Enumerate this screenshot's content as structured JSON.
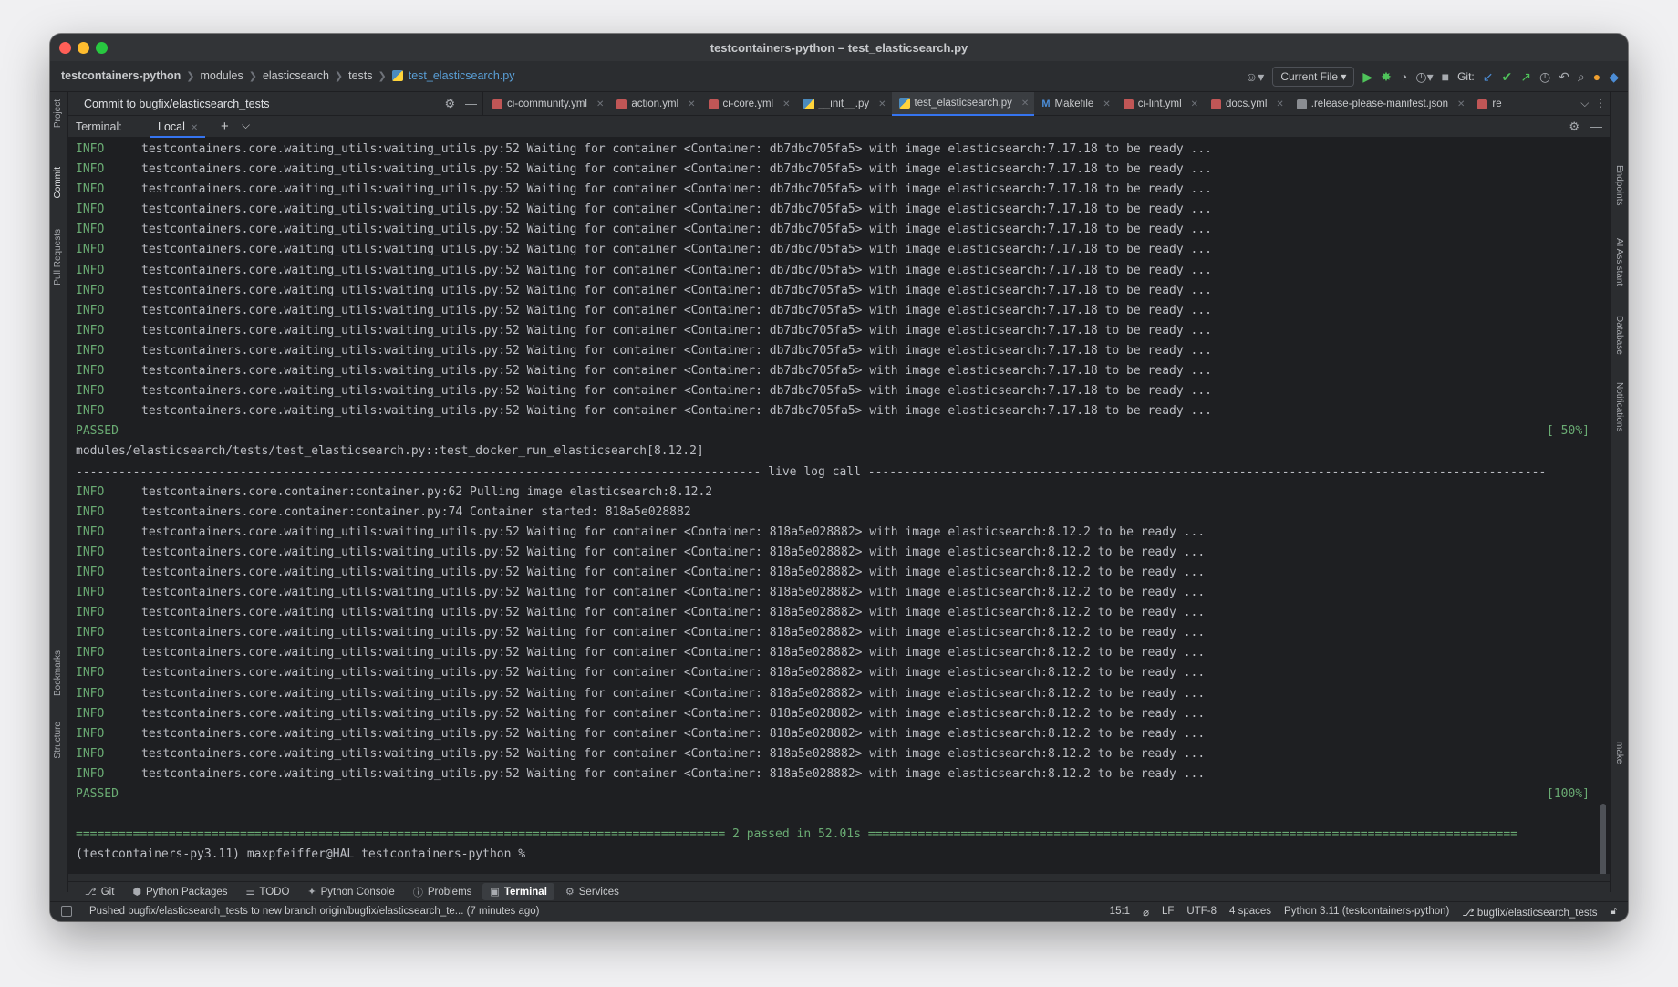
{
  "window": {
    "title": "testcontainers-python – test_elasticsearch.py"
  },
  "breadcrumb": {
    "items": [
      "testcontainers-python",
      "modules",
      "elasticsearch",
      "tests",
      "test_elasticsearch.py"
    ]
  },
  "toolbar": {
    "run_config": "Current File",
    "git_label": "Git:"
  },
  "commit_panel": {
    "title": "Commit to bugfix/elasticsearch_tests"
  },
  "editor_tabs": [
    {
      "label": "ci-community.yml",
      "icon": "yaml-icon"
    },
    {
      "label": "action.yml",
      "icon": "yaml-icon"
    },
    {
      "label": "ci-core.yml",
      "icon": "yaml-icon"
    },
    {
      "label": "__init__.py",
      "icon": "python-file-icon"
    },
    {
      "label": "test_elasticsearch.py",
      "icon": "python-file-icon",
      "active": true
    },
    {
      "label": "Makefile",
      "icon": "makefile-icon"
    },
    {
      "label": "ci-lint.yml",
      "icon": "yaml-icon"
    },
    {
      "label": "docs.yml",
      "icon": "yaml-icon"
    },
    {
      "label": ".release-please-manifest.json",
      "icon": "json-icon"
    },
    {
      "label": "re",
      "icon": "yaml-icon"
    }
  ],
  "left_stripe": [
    "Project",
    "Commit",
    "Pull Requests",
    "Bookmarks",
    "Structure"
  ],
  "right_stripe": [
    "Endpoints",
    "AI Assistant",
    "Database",
    "Notifications",
    "make"
  ],
  "terminal": {
    "label": "Terminal:",
    "tab": "Local",
    "lines": [
      {
        "level": "INFO",
        "text": "testcontainers.core.waiting_utils:waiting_utils.py:52 Waiting for container <Container: db7dbc705fa5> with image elasticsearch:7.17.18 to be ready ..."
      },
      {
        "level": "INFO",
        "text": "testcontainers.core.waiting_utils:waiting_utils.py:52 Waiting for container <Container: db7dbc705fa5> with image elasticsearch:7.17.18 to be ready ..."
      },
      {
        "level": "INFO",
        "text": "testcontainers.core.waiting_utils:waiting_utils.py:52 Waiting for container <Container: db7dbc705fa5> with image elasticsearch:7.17.18 to be ready ..."
      },
      {
        "level": "INFO",
        "text": "testcontainers.core.waiting_utils:waiting_utils.py:52 Waiting for container <Container: db7dbc705fa5> with image elasticsearch:7.17.18 to be ready ..."
      },
      {
        "level": "INFO",
        "text": "testcontainers.core.waiting_utils:waiting_utils.py:52 Waiting for container <Container: db7dbc705fa5> with image elasticsearch:7.17.18 to be ready ..."
      },
      {
        "level": "INFO",
        "text": "testcontainers.core.waiting_utils:waiting_utils.py:52 Waiting for container <Container: db7dbc705fa5> with image elasticsearch:7.17.18 to be ready ..."
      },
      {
        "level": "INFO",
        "text": "testcontainers.core.waiting_utils:waiting_utils.py:52 Waiting for container <Container: db7dbc705fa5> with image elasticsearch:7.17.18 to be ready ..."
      },
      {
        "level": "INFO",
        "text": "testcontainers.core.waiting_utils:waiting_utils.py:52 Waiting for container <Container: db7dbc705fa5> with image elasticsearch:7.17.18 to be ready ..."
      },
      {
        "level": "INFO",
        "text": "testcontainers.core.waiting_utils:waiting_utils.py:52 Waiting for container <Container: db7dbc705fa5> with image elasticsearch:7.17.18 to be ready ..."
      },
      {
        "level": "INFO",
        "text": "testcontainers.core.waiting_utils:waiting_utils.py:52 Waiting for container <Container: db7dbc705fa5> with image elasticsearch:7.17.18 to be ready ..."
      },
      {
        "level": "INFO",
        "text": "testcontainers.core.waiting_utils:waiting_utils.py:52 Waiting for container <Container: db7dbc705fa5> with image elasticsearch:7.17.18 to be ready ..."
      },
      {
        "level": "INFO",
        "text": "testcontainers.core.waiting_utils:waiting_utils.py:52 Waiting for container <Container: db7dbc705fa5> with image elasticsearch:7.17.18 to be ready ..."
      },
      {
        "level": "INFO",
        "text": "testcontainers.core.waiting_utils:waiting_utils.py:52 Waiting for container <Container: db7dbc705fa5> with image elasticsearch:7.17.18 to be ready ..."
      },
      {
        "level": "INFO",
        "text": "testcontainers.core.waiting_utils:waiting_utils.py:52 Waiting for container <Container: db7dbc705fa5> with image elasticsearch:7.17.18 to be ready ..."
      },
      {
        "kind": "passed",
        "text": "PASSED",
        "pct": "[ 50%]"
      },
      {
        "kind": "plain",
        "text": "modules/elasticsearch/tests/test_elasticsearch.py::test_docker_run_elasticsearch[8.12.2]"
      },
      {
        "kind": "sep",
        "text": "------------------------------------------------------------------------------------------------ live log call -----------------------------------------------------------------------------------------------"
      },
      {
        "level": "INFO",
        "text": "testcontainers.core.container:container.py:62 Pulling image elasticsearch:8.12.2"
      },
      {
        "level": "INFO",
        "text": "testcontainers.core.container:container.py:74 Container started: 818a5e028882"
      },
      {
        "level": "INFO",
        "text": "testcontainers.core.waiting_utils:waiting_utils.py:52 Waiting for container <Container: 818a5e028882> with image elasticsearch:8.12.2 to be ready ..."
      },
      {
        "level": "INFO",
        "text": "testcontainers.core.waiting_utils:waiting_utils.py:52 Waiting for container <Container: 818a5e028882> with image elasticsearch:8.12.2 to be ready ..."
      },
      {
        "level": "INFO",
        "text": "testcontainers.core.waiting_utils:waiting_utils.py:52 Waiting for container <Container: 818a5e028882> with image elasticsearch:8.12.2 to be ready ..."
      },
      {
        "level": "INFO",
        "text": "testcontainers.core.waiting_utils:waiting_utils.py:52 Waiting for container <Container: 818a5e028882> with image elasticsearch:8.12.2 to be ready ..."
      },
      {
        "level": "INFO",
        "text": "testcontainers.core.waiting_utils:waiting_utils.py:52 Waiting for container <Container: 818a5e028882> with image elasticsearch:8.12.2 to be ready ..."
      },
      {
        "level": "INFO",
        "text": "testcontainers.core.waiting_utils:waiting_utils.py:52 Waiting for container <Container: 818a5e028882> with image elasticsearch:8.12.2 to be ready ..."
      },
      {
        "level": "INFO",
        "text": "testcontainers.core.waiting_utils:waiting_utils.py:52 Waiting for container <Container: 818a5e028882> with image elasticsearch:8.12.2 to be ready ..."
      },
      {
        "level": "INFO",
        "text": "testcontainers.core.waiting_utils:waiting_utils.py:52 Waiting for container <Container: 818a5e028882> with image elasticsearch:8.12.2 to be ready ..."
      },
      {
        "level": "INFO",
        "text": "testcontainers.core.waiting_utils:waiting_utils.py:52 Waiting for container <Container: 818a5e028882> with image elasticsearch:8.12.2 to be ready ..."
      },
      {
        "level": "INFO",
        "text": "testcontainers.core.waiting_utils:waiting_utils.py:52 Waiting for container <Container: 818a5e028882> with image elasticsearch:8.12.2 to be ready ..."
      },
      {
        "level": "INFO",
        "text": "testcontainers.core.waiting_utils:waiting_utils.py:52 Waiting for container <Container: 818a5e028882> with image elasticsearch:8.12.2 to be ready ..."
      },
      {
        "level": "INFO",
        "text": "testcontainers.core.waiting_utils:waiting_utils.py:52 Waiting for container <Container: 818a5e028882> with image elasticsearch:8.12.2 to be ready ..."
      },
      {
        "level": "INFO",
        "text": "testcontainers.core.waiting_utils:waiting_utils.py:52 Waiting for container <Container: 818a5e028882> with image elasticsearch:8.12.2 to be ready ..."
      },
      {
        "kind": "passed",
        "text": "PASSED",
        "pct": "[100%]"
      },
      {
        "kind": "blank",
        "text": ""
      },
      {
        "kind": "summary",
        "text": "=========================================================================================== 2 passed in 52.01s ==========================================================================================="
      },
      {
        "kind": "prompt",
        "text": "(testcontainers-py3.11) maxpfeiffer@HAL testcontainers-python % "
      }
    ]
  },
  "tool_windows": [
    {
      "label": "Git",
      "icon": "git-branch-icon"
    },
    {
      "label": "Python Packages",
      "icon": "packages-icon"
    },
    {
      "label": "TODO",
      "icon": "todo-list-icon"
    },
    {
      "label": "Python Console",
      "icon": "python-console-icon"
    },
    {
      "label": "Problems",
      "icon": "problems-icon"
    },
    {
      "label": "Terminal",
      "icon": "terminal-icon",
      "active": true
    },
    {
      "label": "Services",
      "icon": "services-icon"
    }
  ],
  "statusbar": {
    "message": "Pushed bugfix/elasticsearch_tests to new branch origin/bugfix/elasticsearch_te... (7 minutes ago)",
    "position": "15:1",
    "line_sep": "LF",
    "encoding": "UTF-8",
    "indent": "4 spaces",
    "interpreter": "Python 3.11 (testcontainers-python)",
    "branch": "bugfix/elasticsearch_tests"
  },
  "colors": {
    "accent": "#3574f0",
    "info": "#6aab73",
    "terminal_bg": "#1e1f22",
    "panel_bg": "#2b2d30"
  }
}
